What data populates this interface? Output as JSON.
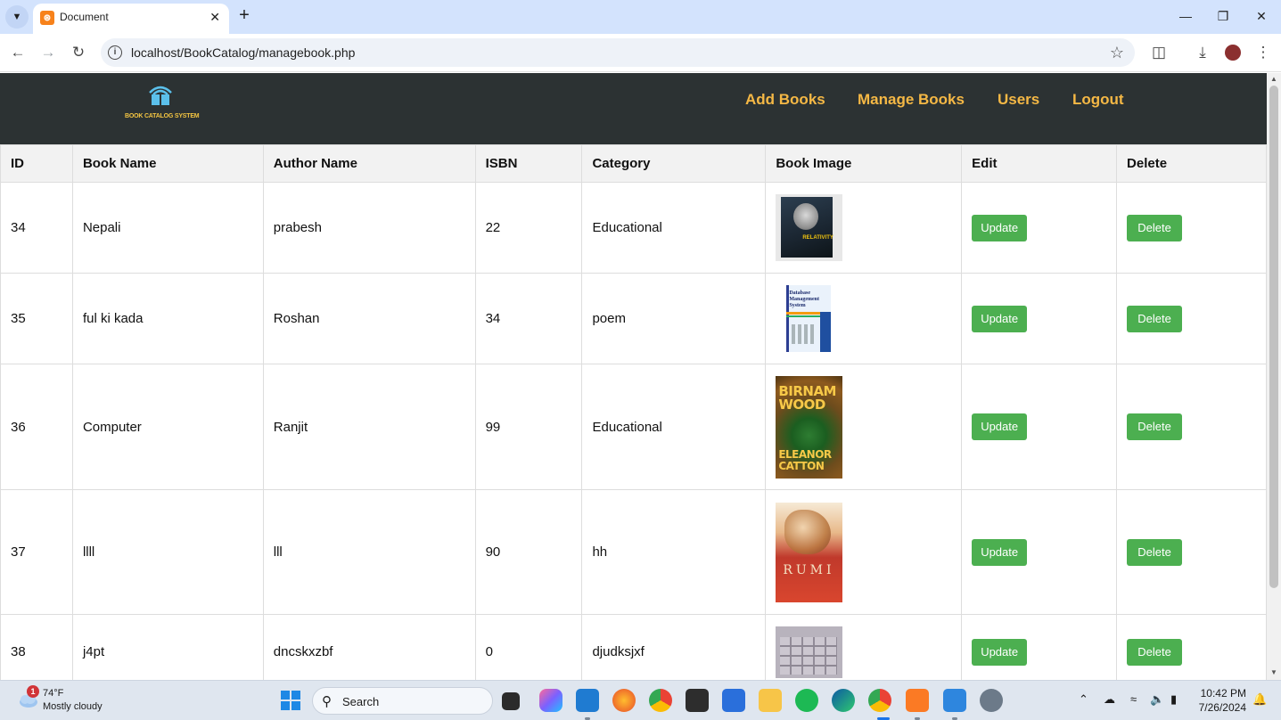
{
  "browser": {
    "tab_title": "Document",
    "url": "localhost/BookCatalog/managebook.php"
  },
  "site": {
    "logo_text": "BOOK CATALOG SYSTEM",
    "nav": [
      {
        "label": "Add Books"
      },
      {
        "label": "Manage Books"
      },
      {
        "label": "Users"
      },
      {
        "label": "Logout"
      }
    ]
  },
  "table": {
    "headers": [
      "ID",
      "Book Name",
      "Author Name",
      "ISBN",
      "Category",
      "Book Image",
      "Edit",
      "Delete"
    ],
    "rows": [
      {
        "id": "34",
        "name": "Nepali",
        "author": "prabesh",
        "isbn": "22",
        "category": "Educational",
        "cover": "relativity-cover"
      },
      {
        "id": "35",
        "name": "ful ki kada",
        "author": "Roshan",
        "isbn": "34",
        "category": "poem",
        "cover": "database-management-system-cover"
      },
      {
        "id": "36",
        "name": "Computer",
        "author": "Ranjit",
        "isbn": "99",
        "category": "Educational",
        "cover": "birnam-wood-cover"
      },
      {
        "id": "37",
        "name": "llll",
        "author": "lll",
        "isbn": "90",
        "category": "hh",
        "cover": "rumi-cover"
      },
      {
        "id": "38",
        "name": "j4pt",
        "author": "dncskxzbf",
        "isbn": "0",
        "category": "djudksjxf",
        "cover": "keypad-cover"
      }
    ],
    "update_label": "Update",
    "delete_label": "Delete",
    "button_color": "#4caf50"
  },
  "covers": {
    "relativity": "RELATIVITY",
    "dbms": "Database Management System",
    "birnam_title": "BIRNAM WOOD",
    "birnam_author": "ELEANOR CATTON",
    "rumi": "RUMI"
  },
  "taskbar": {
    "weather_badge": "1",
    "temperature": "74°F",
    "weather_desc": "Mostly cloudy",
    "search_placeholder": "Search",
    "time": "10:42 PM",
    "date": "7/26/2024"
  },
  "colors": {
    "header_bg": "#2c3233",
    "nav_link": "#f5b845",
    "tabbar_bg": "#d3e3fd"
  }
}
